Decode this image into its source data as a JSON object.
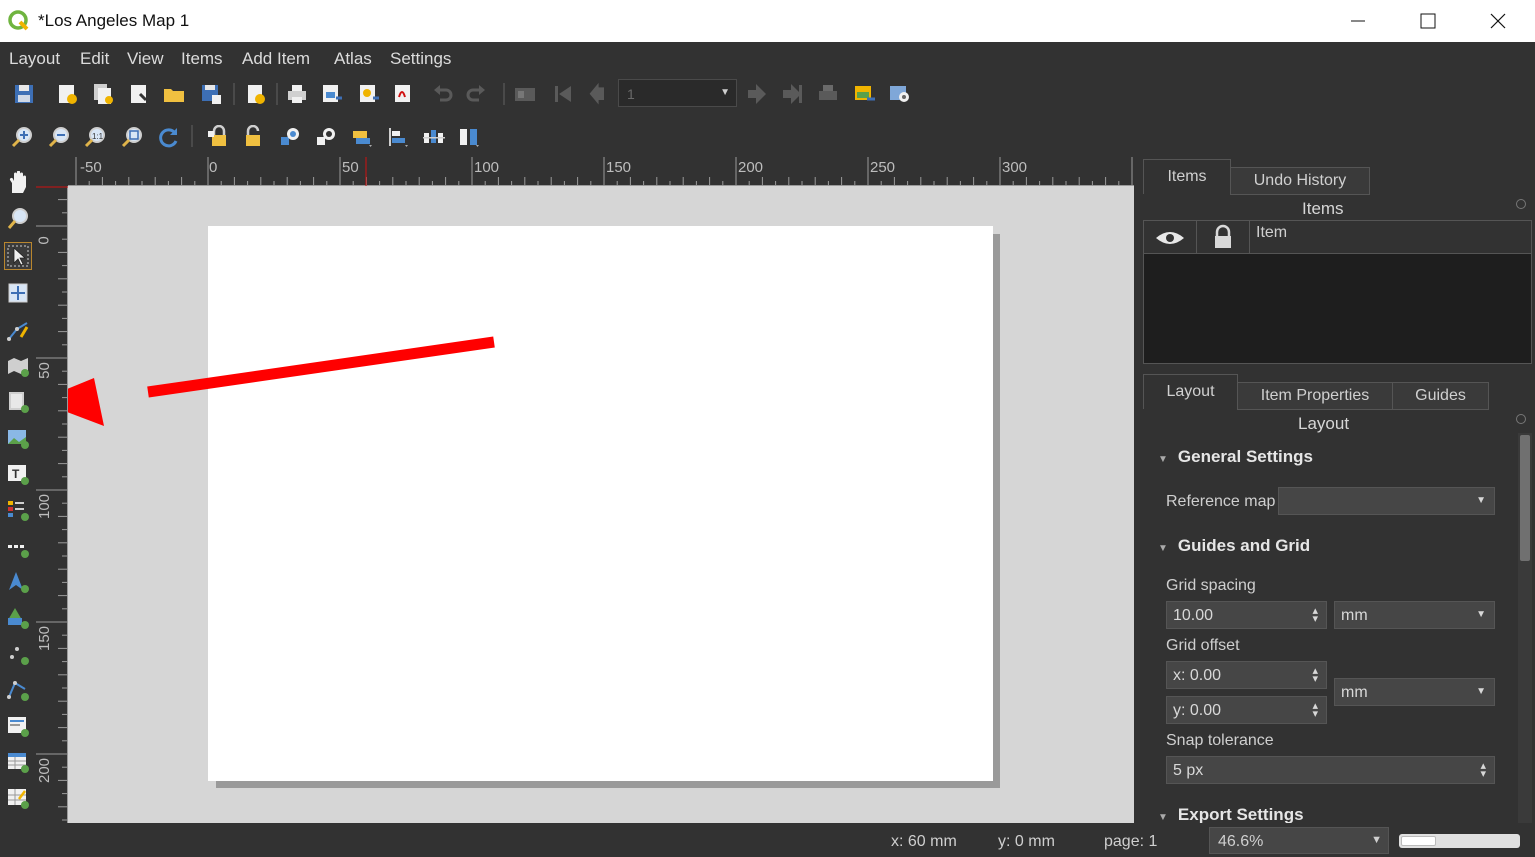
{
  "window": {
    "title": "*Los Angeles Map 1",
    "controls": {
      "minimize": "minimize-icon",
      "maximize": "maximize-icon",
      "close": "close-icon"
    }
  },
  "menu": [
    "Layout",
    "Edit",
    "View",
    "Items",
    "Add Item",
    "Atlas",
    "Settings"
  ],
  "toolbar": {
    "page_number": "1"
  },
  "rulers": {
    "horizontal": [
      "-50",
      "0",
      "50",
      "100",
      "150",
      "200",
      "250",
      "300"
    ],
    "vertical": [
      "0",
      "50",
      "100",
      "150",
      "200"
    ]
  },
  "items_panel": {
    "tabs": [
      "Items",
      "Undo History"
    ],
    "title": "Items",
    "column_item": "Item"
  },
  "layout_panel": {
    "tabs": [
      "Layout",
      "Item Properties",
      "Guides"
    ],
    "title": "Layout",
    "general_settings": "General Settings",
    "reference_map_label": "Reference map",
    "reference_map_value": "",
    "guides_and_grid": "Guides and Grid",
    "grid_spacing_label": "Grid spacing",
    "grid_spacing_value": "10.00",
    "grid_spacing_unit": "mm",
    "grid_offset_label": "Grid offset",
    "grid_offset_x": "x: 0.00",
    "grid_offset_y": "y: 0.00",
    "grid_offset_unit": "mm",
    "snap_tolerance_label": "Snap tolerance",
    "snap_tolerance_value": "5 px",
    "export_settings": "Export Settings"
  },
  "status": {
    "x": "x: 60 mm",
    "y": "y: 0 mm",
    "page": "page: 1",
    "zoom": "46.6%",
    "zoom_slider_fraction": 0.3
  },
  "colors": {
    "accent_arrow": "#ff0000",
    "background": "#323232",
    "canvas": "#d6d6d6",
    "page": "#ffffff"
  }
}
